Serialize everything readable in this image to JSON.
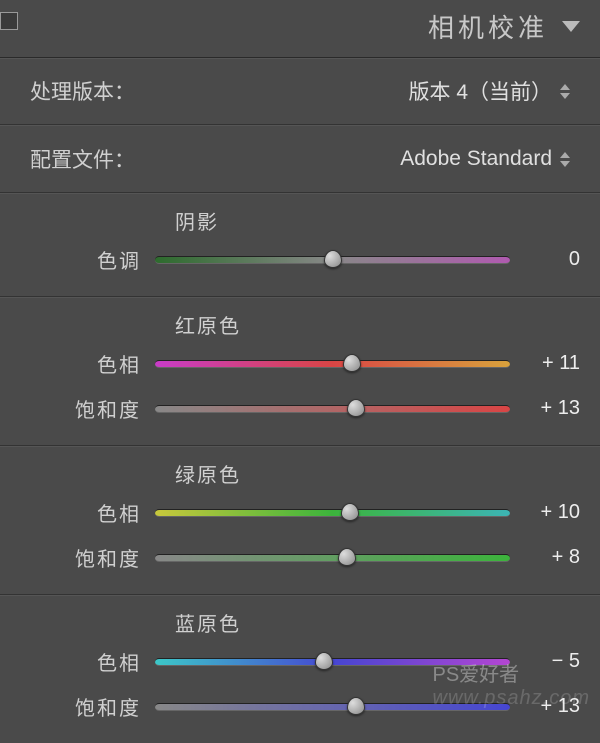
{
  "header": {
    "title": "相机校准"
  },
  "process_version": {
    "label": "处理版本：",
    "value": "版本 4（当前）"
  },
  "profile": {
    "label": "配置文件：",
    "value": "Adobe Standard"
  },
  "sections": {
    "shadow": {
      "title": "阴影",
      "tint": {
        "label": "色调",
        "value": "0",
        "pos": 50
      }
    },
    "red": {
      "title": "红原色",
      "hue": {
        "label": "色相",
        "value": "+ 11",
        "pos": 55.5
      },
      "sat": {
        "label": "饱和度",
        "value": "+ 13",
        "pos": 56.5
      }
    },
    "green": {
      "title": "绿原色",
      "hue": {
        "label": "色相",
        "value": "+ 10",
        "pos": 55
      },
      "sat": {
        "label": "饱和度",
        "value": "+ 8",
        "pos": 54
      }
    },
    "blue": {
      "title": "蓝原色",
      "hue": {
        "label": "色相",
        "value": "− 5",
        "pos": 47.5
      },
      "sat": {
        "label": "饱和度",
        "value": "+ 13",
        "pos": 56.5
      }
    }
  },
  "watermark": {
    "text": "PS爱好者",
    "url": "www.psahz.com"
  }
}
